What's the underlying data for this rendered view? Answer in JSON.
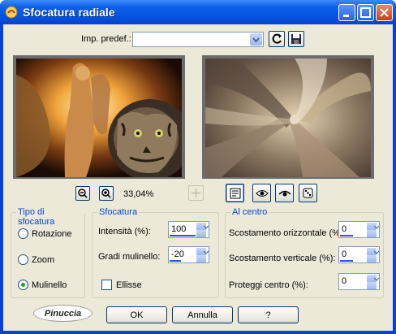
{
  "window": {
    "title": "Sfocatura radiale"
  },
  "preset": {
    "label": "Imp. predef.:",
    "value": ""
  },
  "zoom": {
    "value": "33,04%"
  },
  "groups": {
    "tipo": {
      "title": "Tipo di sfocatura",
      "options": [
        "Rotazione",
        "Zoom",
        "Mulinello"
      ],
      "selected": "Mulinello"
    },
    "sfocatura": {
      "title": "Sfocatura",
      "intensita_label": "Intensità (%):",
      "intensita_value": "100",
      "intensita_level": 1.0,
      "gradi_label": "Gradi mulinello:",
      "gradi_value": "-20",
      "gradi_level": 0.45,
      "ellisse_label": "Ellisse",
      "ellisse_checked": false
    },
    "centro": {
      "title": "Al centro",
      "orizz_label": "Scostamento orizzontale (%):",
      "orizz_value": "0",
      "orizz_level": 0.5,
      "vert_label": "Scostamento verticale (%):",
      "vert_value": "0",
      "vert_level": 0.5,
      "proteggi_label": "Proteggi centro (%):",
      "proteggi_value": "0"
    }
  },
  "logo": {
    "text": "Pinuccia"
  },
  "buttons": {
    "ok": "OK",
    "annulla": "Annulla",
    "help": "?"
  },
  "colors": {
    "title_bar": "#0554e0",
    "group_title": "#0046d5",
    "dialog_bg": "#ece9d8"
  }
}
